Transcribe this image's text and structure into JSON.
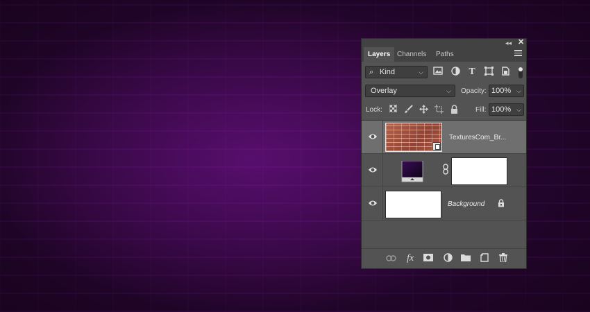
{
  "panel": {
    "tabs": [
      {
        "label": "Layers",
        "active": true
      },
      {
        "label": "Channels",
        "active": false
      },
      {
        "label": "Paths",
        "active": false
      }
    ],
    "filter": {
      "kind_label": "Kind",
      "icons": [
        "image-filter-icon",
        "adjustment-filter-icon",
        "type-filter-icon",
        "shape-filter-icon",
        "smart-object-filter-icon"
      ]
    },
    "blend_mode": "Overlay",
    "opacity_label": "Opacity:",
    "opacity_value": "100%",
    "lock_label": "Lock:",
    "fill_label": "Fill:",
    "fill_value": "100%",
    "layers": [
      {
        "name": "TexturesCom_Br...",
        "type": "smart-object",
        "selected": true,
        "visible": true
      },
      {
        "name": "",
        "type": "gradient-map-adjustment",
        "selected": false,
        "visible": true,
        "has_mask": true
      },
      {
        "name": "Background",
        "type": "background",
        "selected": false,
        "visible": true,
        "locked": true
      }
    ],
    "bottom_icons": [
      "link-icon",
      "fx-icon",
      "add-mask-icon",
      "adjustment-icon",
      "group-folder-icon",
      "new-layer-icon",
      "trash-icon"
    ],
    "fx_label": "fx",
    "kind_search_glyph": "⌕"
  },
  "colors": {
    "panel_bg": "#535353",
    "canvas_accent": "#6a1a84",
    "selected_row": "#6f6f6f"
  }
}
